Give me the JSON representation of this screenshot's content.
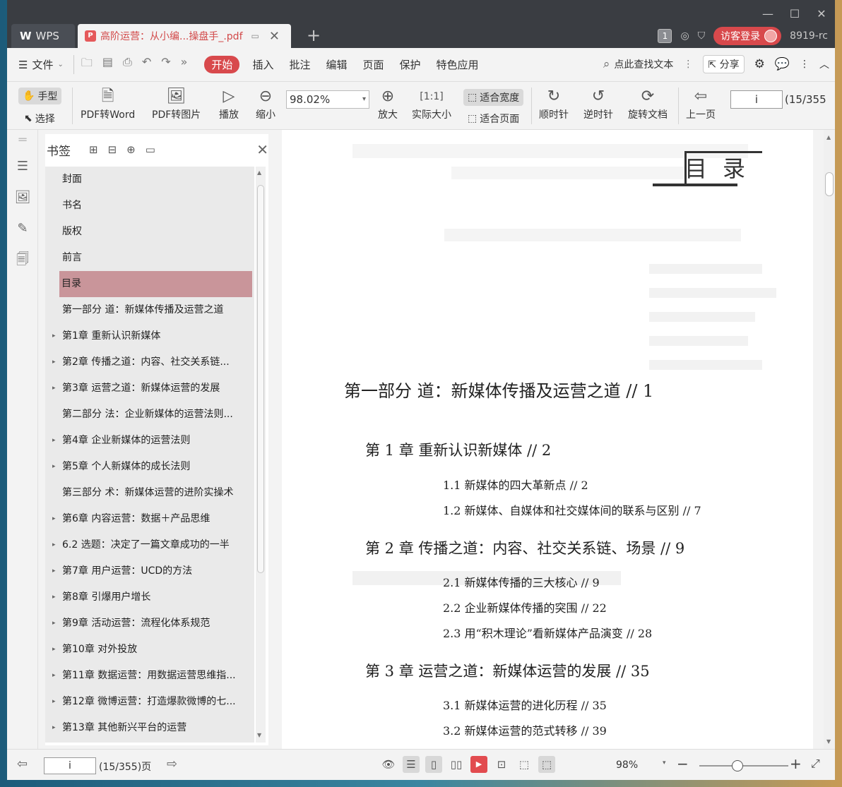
{
  "titlebar": {
    "wps_tab": "WPS",
    "doc_tab": "高阶运营：从小编...操盘手_.pdf",
    "badge_num": "1",
    "login": "访客登录",
    "user_id": "8919-rc"
  },
  "menubar": {
    "file": "文件",
    "start": "开始",
    "items": [
      "插入",
      "批注",
      "编辑",
      "页面",
      "保护",
      "特色应用"
    ],
    "search": "点此查找文本",
    "share": "分享"
  },
  "toolbar": {
    "hand": "手型",
    "select": "选择",
    "pdf_word": "PDF转Word",
    "pdf_img": "PDF转图片",
    "play": "播放",
    "zoom_out": "缩小",
    "zoom_value": "98.02%",
    "zoom_in": "放大",
    "actual_size": "实际大小",
    "fit_width": "适合宽度",
    "fit_page": "适合页面",
    "clockwise": "顺时针",
    "counter": "逆时针",
    "rotate_doc": "旋转文档",
    "prev_page": "上一页",
    "page_input": "i",
    "page_count": "(15/355"
  },
  "bookmarks": {
    "title": "书签",
    "items": [
      {
        "label": "封面",
        "arrow": false
      },
      {
        "label": "书名",
        "arrow": false
      },
      {
        "label": "版权",
        "arrow": false
      },
      {
        "label": "前言",
        "arrow": false
      },
      {
        "label": "目录",
        "arrow": false,
        "selected": true
      },
      {
        "label": "第一部分  道：新媒体传播及运营之道",
        "arrow": false
      },
      {
        "label": "第1章  重新认识新媒体",
        "arrow": true
      },
      {
        "label": "第2章  传播之道：内容、社交关系链...",
        "arrow": true
      },
      {
        "label": "第3章  运营之道：新媒体运营的发展",
        "arrow": true
      },
      {
        "label": "第二部分  法：企业新媒体的运营法则...",
        "arrow": false
      },
      {
        "label": "第4章  企业新媒体的运营法则",
        "arrow": true
      },
      {
        "label": "第5章  个人新媒体的成长法则",
        "arrow": true
      },
      {
        "label": "第三部分  术：新媒体运营的进阶实操术",
        "arrow": false
      },
      {
        "label": "第6章  内容运营：数据＋产品思维",
        "arrow": true
      },
      {
        "label": "6.2  选题：决定了一篇文章成功的一半",
        "arrow": true
      },
      {
        "label": "第7章  用户运营：UCD的方法",
        "arrow": true
      },
      {
        "label": "第8章  引爆用户增长",
        "arrow": true
      },
      {
        "label": "第9章  活动运营：流程化体系规范",
        "arrow": true
      },
      {
        "label": "第10章  对外投放",
        "arrow": true
      },
      {
        "label": "第11章  数据运营：用数据运营思维指...",
        "arrow": true
      },
      {
        "label": "第12章  微博运营：打造爆款微博的七...",
        "arrow": true
      },
      {
        "label": "第13章  其他新兴平台的运营",
        "arrow": true
      }
    ]
  },
  "page": {
    "heading": "目录",
    "toc": [
      {
        "kind": "part",
        "text": "第一部分    道：新媒体传播及运营之道    // 1"
      },
      {
        "kind": "chap",
        "text": "第 1 章    重新认识新媒体    // 2"
      },
      {
        "kind": "sec",
        "text": "1.1    新媒体的四大革新点    // 2"
      },
      {
        "kind": "sec",
        "text": "1.2    新媒体、自媒体和社交媒体间的联系与区别    // 7"
      },
      {
        "kind": "chap",
        "text": "第 2 章    传播之道：内容、社交关系链、场景    // 9"
      },
      {
        "kind": "sec",
        "text": "2.1    新媒体传播的三大核心    // 9"
      },
      {
        "kind": "sec",
        "text": "2.2    企业新媒体传播的突围    // 22"
      },
      {
        "kind": "sec",
        "text": "2.3    用“积木理论”看新媒体产品演变    // 28"
      },
      {
        "kind": "chap",
        "text": "第 3 章    运营之道：新媒体运营的发展    // 35"
      },
      {
        "kind": "sec",
        "text": "3.1    新媒体运营的进化历程    // 35"
      },
      {
        "kind": "sec",
        "text": "3.2    新媒体运营的范式转移    // 39"
      }
    ]
  },
  "statusbar": {
    "page_input": "i",
    "page_count": "(15/355)页",
    "zoom": "98%",
    "zoom_level_percent": 98
  },
  "colors": {
    "accent": "#d8494c",
    "selected_bookmark": "#c9959a",
    "titlebar": "#3a3d42"
  }
}
